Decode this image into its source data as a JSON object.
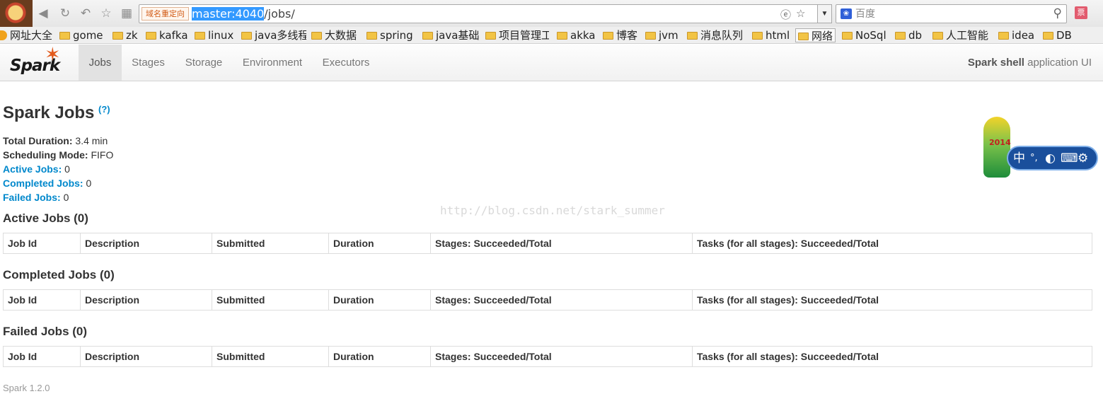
{
  "browser": {
    "redirect_badge": "域名重定向",
    "url_selected": "master:4040",
    "url_rest": "/jobs/",
    "search_placeholder": "百度",
    "ticket_label": "票",
    "bookmarks": [
      "网址大全",
      "gome",
      "zk",
      "kafka",
      "linux",
      "java多线程",
      "大数据",
      "spring",
      "java基础",
      "项目管理工",
      "akka",
      "博客",
      "jvm",
      "消息队列",
      "html",
      "网络",
      "NoSql",
      "db",
      "人工智能",
      "idea",
      "DB"
    ]
  },
  "spark": {
    "logo_text": "Spark",
    "tabs": [
      "Jobs",
      "Stages",
      "Storage",
      "Environment",
      "Executors"
    ],
    "active_tab": "Jobs",
    "app_title_bold": "Spark shell",
    "app_title_rest": " application UI"
  },
  "page": {
    "title": "Spark Jobs",
    "help": "(?)",
    "summary": {
      "total_duration_label": "Total Duration:",
      "total_duration_value": " 3.4 min",
      "scheduling_mode_label": "Scheduling Mode:",
      "scheduling_mode_value": " FIFO",
      "active_jobs_label": "Active Jobs:",
      "active_jobs_value": " 0",
      "completed_jobs_label": "Completed Jobs:",
      "completed_jobs_value": " 0",
      "failed_jobs_label": "Failed Jobs:",
      "failed_jobs_value": " 0"
    },
    "sections": [
      {
        "title": "Active Jobs (0)"
      },
      {
        "title": "Completed Jobs (0)"
      },
      {
        "title": "Failed Jobs (0)"
      }
    ],
    "columns": [
      "Job Id",
      "Description",
      "Submitted",
      "Duration",
      "Stages: Succeeded/Total",
      "Tasks (for all stages): Succeeded/Total"
    ],
    "footer": "Spark 1.2.0"
  },
  "watermark": "http://blog.csdn.net/stark_summer",
  "ime": {
    "label_zh": "中",
    "dot": "°,",
    "moon": "◐",
    "keyboard": "⌨",
    "gear": "⚙"
  },
  "badge": {
    "year": "2014"
  }
}
